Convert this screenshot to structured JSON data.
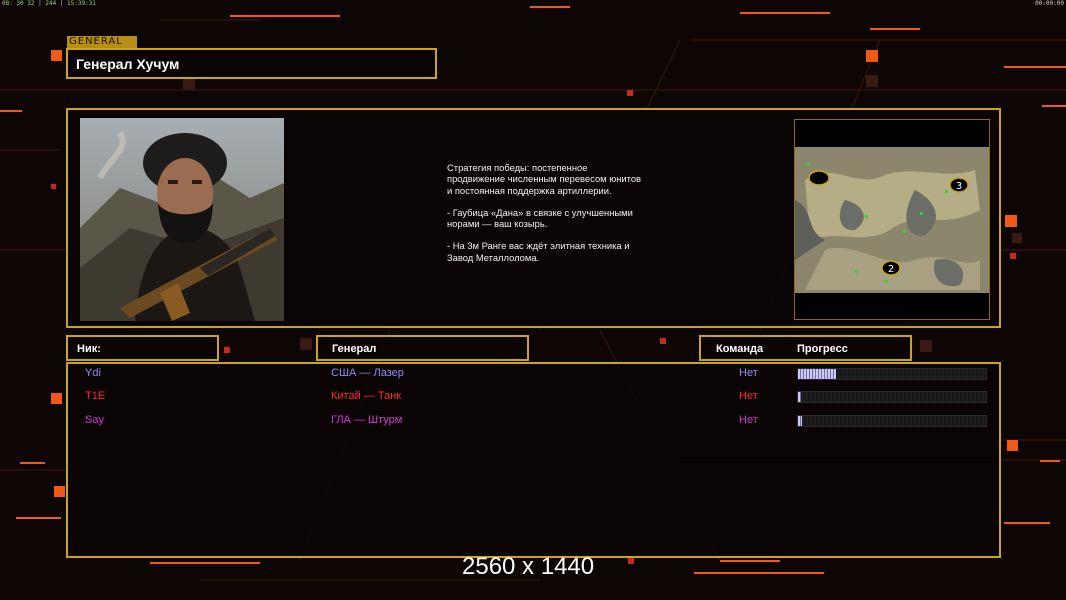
{
  "hud": {
    "top_left": "08: 30 32 | 244 | 15:39:31",
    "top_right": "00:00:00"
  },
  "general": {
    "tag": "GENERAL",
    "name": "Генерал Хучум"
  },
  "description": {
    "p1": "Стратегия победы: постепенное продвижение численным перевесом юнитов и постоянная поддержка артиллерии.",
    "p2": "- Гаубица «Дана» в связке с улучшенными норами — ваш козырь.",
    "p3": "- На 3м Ранге вас ждёт элитная техника и Завод Металлолома."
  },
  "map": {
    "markers": [
      "3",
      "2"
    ]
  },
  "columns": {
    "nick": "Ник:",
    "general": "Генерал",
    "team": "Команда",
    "progress": "Прогресс"
  },
  "players": [
    {
      "nick": "Ydi",
      "general": "США — Лазер",
      "team": "Нет",
      "progress": 0.2,
      "color": "#8e8ef2"
    },
    {
      "nick": "T1E",
      "general": "Китай — Танк",
      "team": "Нет",
      "progress": 0.01,
      "color": "#ff2a2a"
    },
    {
      "nick": "Say",
      "general": "ГЛА — Штурм",
      "team": "Нет",
      "progress": 0.02,
      "color": "#d23ad8"
    }
  ],
  "resolution_label": "2560 x 1440",
  "colors": {
    "frame": "#c9a51c",
    "accent": "#f05a14"
  }
}
